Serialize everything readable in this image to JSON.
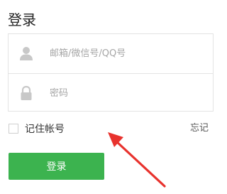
{
  "header": {
    "title": "登录"
  },
  "form": {
    "username_placeholder": "邮箱/微信号/QQ号",
    "password_placeholder": "密码",
    "remember_label": "记住帐号",
    "forgot_label": "忘记",
    "submit_label": "登录"
  },
  "colors": {
    "primary_button": "#3cb34f",
    "arrow": "#e8322d",
    "border": "#e3e3e3"
  },
  "icons": {
    "username": "user-icon",
    "password": "lock-icon",
    "annotation": "red-arrow-icon"
  }
}
